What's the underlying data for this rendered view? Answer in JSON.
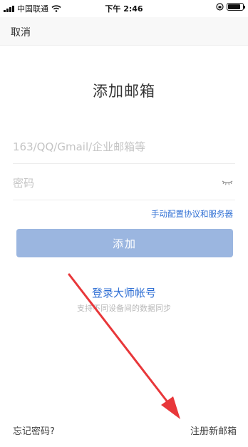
{
  "status_bar": {
    "carrier": "中国联通",
    "time": "下午 2:46"
  },
  "nav": {
    "cancel_label": "取消"
  },
  "page": {
    "title": "添加邮箱"
  },
  "form": {
    "email_placeholder": "163/QQ/Gmail/企业邮箱等",
    "password_placeholder": "密码",
    "manual_config_label": "手动配置协议和服务器",
    "add_button_label": "添加"
  },
  "master_account": {
    "login_label": "登录大师帐号",
    "caption": "支持不同设备间的数据同步"
  },
  "footer": {
    "forgot_password_label": "忘记密码?",
    "register_label": "注册新邮箱"
  },
  "colors": {
    "accent": "#2f6fd4",
    "button_disabled": "#9bb6e0",
    "annotation_arrow": "#e8373a"
  }
}
